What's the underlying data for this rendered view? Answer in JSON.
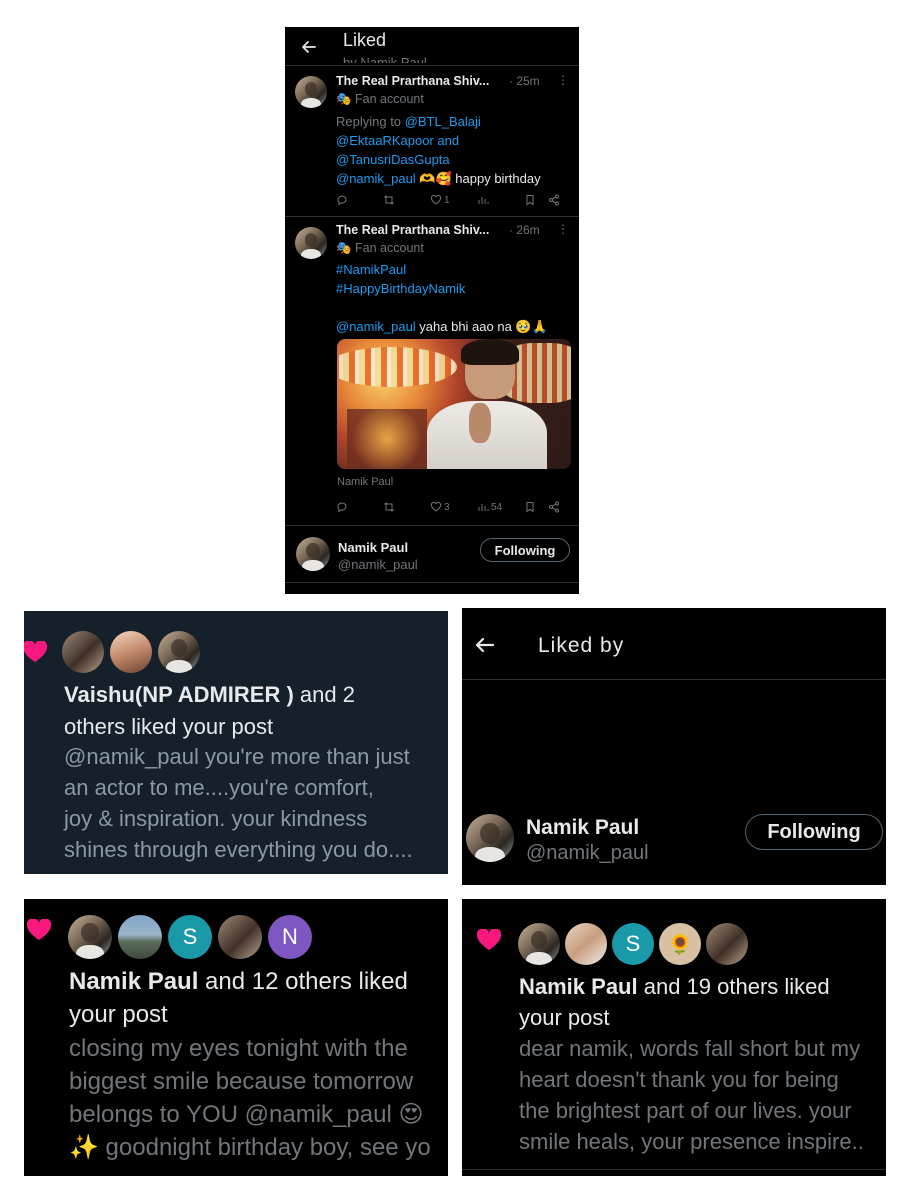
{
  "liked_page": {
    "title": "Liked",
    "subtitle": "by Namik Paul",
    "tweets": [
      {
        "author": "The Real Prarthana Shiv...",
        "time": "· 25m",
        "badge": "🎭 Fan account",
        "replying_label": "Replying to",
        "replying_lines": [
          "@BTL_Balaji",
          "@EktaaRKapoor and",
          "@TanusriDasGupta"
        ],
        "mention": "@namik_paul",
        "text": " 🫶🥰 happy birthday",
        "likes": "1"
      },
      {
        "author": "The Real Prarthana Shiv...",
        "time": "· 26m",
        "badge": "🎭 Fan account",
        "hashtag1": "#NamikPaul",
        "hashtag2": "#HappyBirthdayNamik",
        "mention": "@namik_paul",
        "text": " yaha bhi aao na 🥹🙏",
        "image_caption": "Namik Paul",
        "likes": "3",
        "views": "54"
      }
    ],
    "user": {
      "name": "Namik Paul",
      "handle": "@namik_paul",
      "button": "Following"
    }
  },
  "notif_blue": {
    "name": "Vaishu(NP ADMIRER )",
    "suffix": " and 2",
    "line2": "others liked your post",
    "post_lines": [
      "@namik_paul you're more than just",
      "an actor to me....you're comfort,",
      "joy & inspiration. your kindness",
      "shines through everything you do...."
    ]
  },
  "liked_by": {
    "title": "Liked by",
    "user": {
      "name": "Namik Paul",
      "handle": "@namik_paul",
      "button": "Following"
    }
  },
  "notif_12": {
    "avatar_s": "S",
    "avatar_n": "N",
    "name": "Namik Paul",
    "suffix": " and 12 others liked",
    "line2": "your post",
    "post_lines": [
      "closing my eyes tonight with the",
      "biggest smile because tomorrow",
      "belongs to YOU @namik_paul 😍",
      "✨ goodnight birthday boy, see yo"
    ]
  },
  "notif_19": {
    "avatar_s": "S",
    "name": "Namik Paul",
    "suffix": " and 19 others liked",
    "line2": "your post",
    "post_lines": [
      "dear namik, words fall short but my",
      "heart doesn't thank you for being",
      "the brightest part of our lives. your",
      "smile heals, your presence inspire.."
    ]
  },
  "colors": {
    "accent": "#1d9bf0",
    "heart": "#f91880",
    "navy": "#15202b"
  },
  "icons": [
    "back-arrow-icon",
    "more-icon",
    "reply-icon",
    "retweet-icon",
    "like-icon",
    "views-icon",
    "bookmark-icon",
    "share-icon",
    "heart-icon"
  ]
}
